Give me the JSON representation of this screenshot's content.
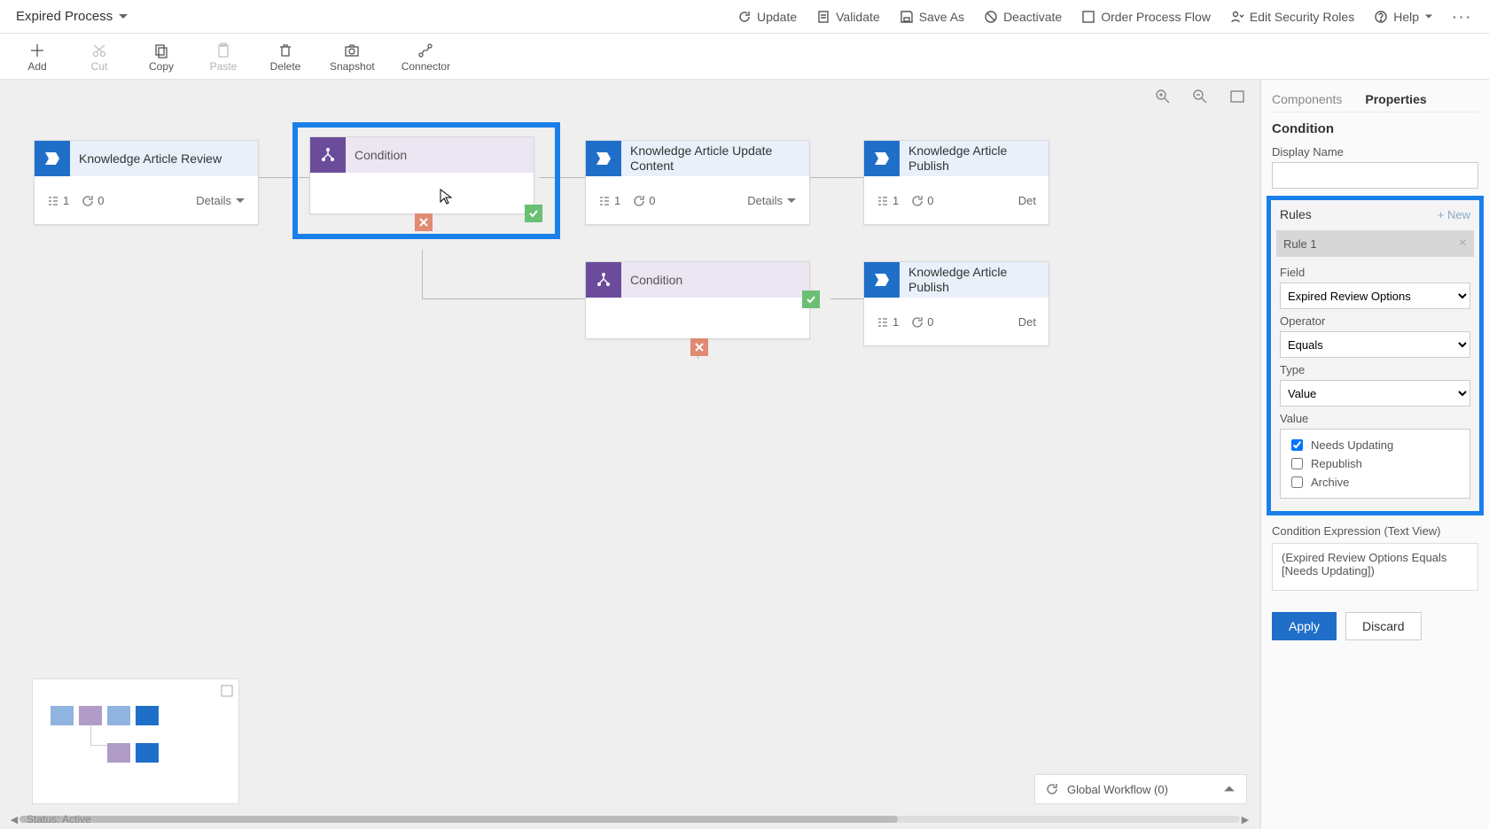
{
  "header": {
    "process_name": "Expired Process",
    "actions": {
      "update": "Update",
      "validate": "Validate",
      "save_as": "Save As",
      "deactivate": "Deactivate",
      "order": "Order Process Flow",
      "roles": "Edit Security Roles",
      "help": "Help"
    }
  },
  "toolbar": {
    "add": "Add",
    "cut": "Cut",
    "copy": "Copy",
    "paste": "Paste",
    "delete": "Delete",
    "snapshot": "Snapshot",
    "connector": "Connector"
  },
  "canvas": {
    "stages": [
      {
        "id": "s1",
        "title": "Knowledge Article Review",
        "steps": "1",
        "cycles": "0",
        "details": "Details"
      },
      {
        "id": "s2",
        "title": "Knowledge Article Update Content",
        "steps": "1",
        "cycles": "0",
        "details": "Details"
      },
      {
        "id": "s3",
        "title": "Knowledge Article Publish",
        "steps": "1",
        "cycles": "0",
        "details": "Det"
      },
      {
        "id": "s4",
        "title": "Knowledge Article Publish",
        "steps": "1",
        "cycles": "0",
        "details": "Det"
      }
    ],
    "conditions": [
      {
        "id": "c1",
        "title": "Condition"
      },
      {
        "id": "c2",
        "title": "Condition"
      }
    ],
    "global_workflow": "Global Workflow (0)"
  },
  "panel": {
    "tabs": {
      "components": "Components",
      "properties": "Properties"
    },
    "section_title": "Condition",
    "display_name_label": "Display Name",
    "display_name_value": "",
    "rules_label": "Rules",
    "new_rule_label": "+ New",
    "rule1_label": "Rule 1",
    "field_label": "Field",
    "field_value": "Expired Review Options",
    "operator_label": "Operator",
    "operator_value": "Equals",
    "type_label": "Type",
    "type_value": "Value",
    "value_label": "Value",
    "value_options": {
      "needs_updating": "Needs Updating",
      "republish": "Republish",
      "archive": "Archive"
    },
    "expr_label": "Condition Expression (Text View)",
    "expr_value": "(Expired Review Options Equals [Needs Updating])",
    "apply": "Apply",
    "discard": "Discard"
  },
  "status": "Status: Active"
}
